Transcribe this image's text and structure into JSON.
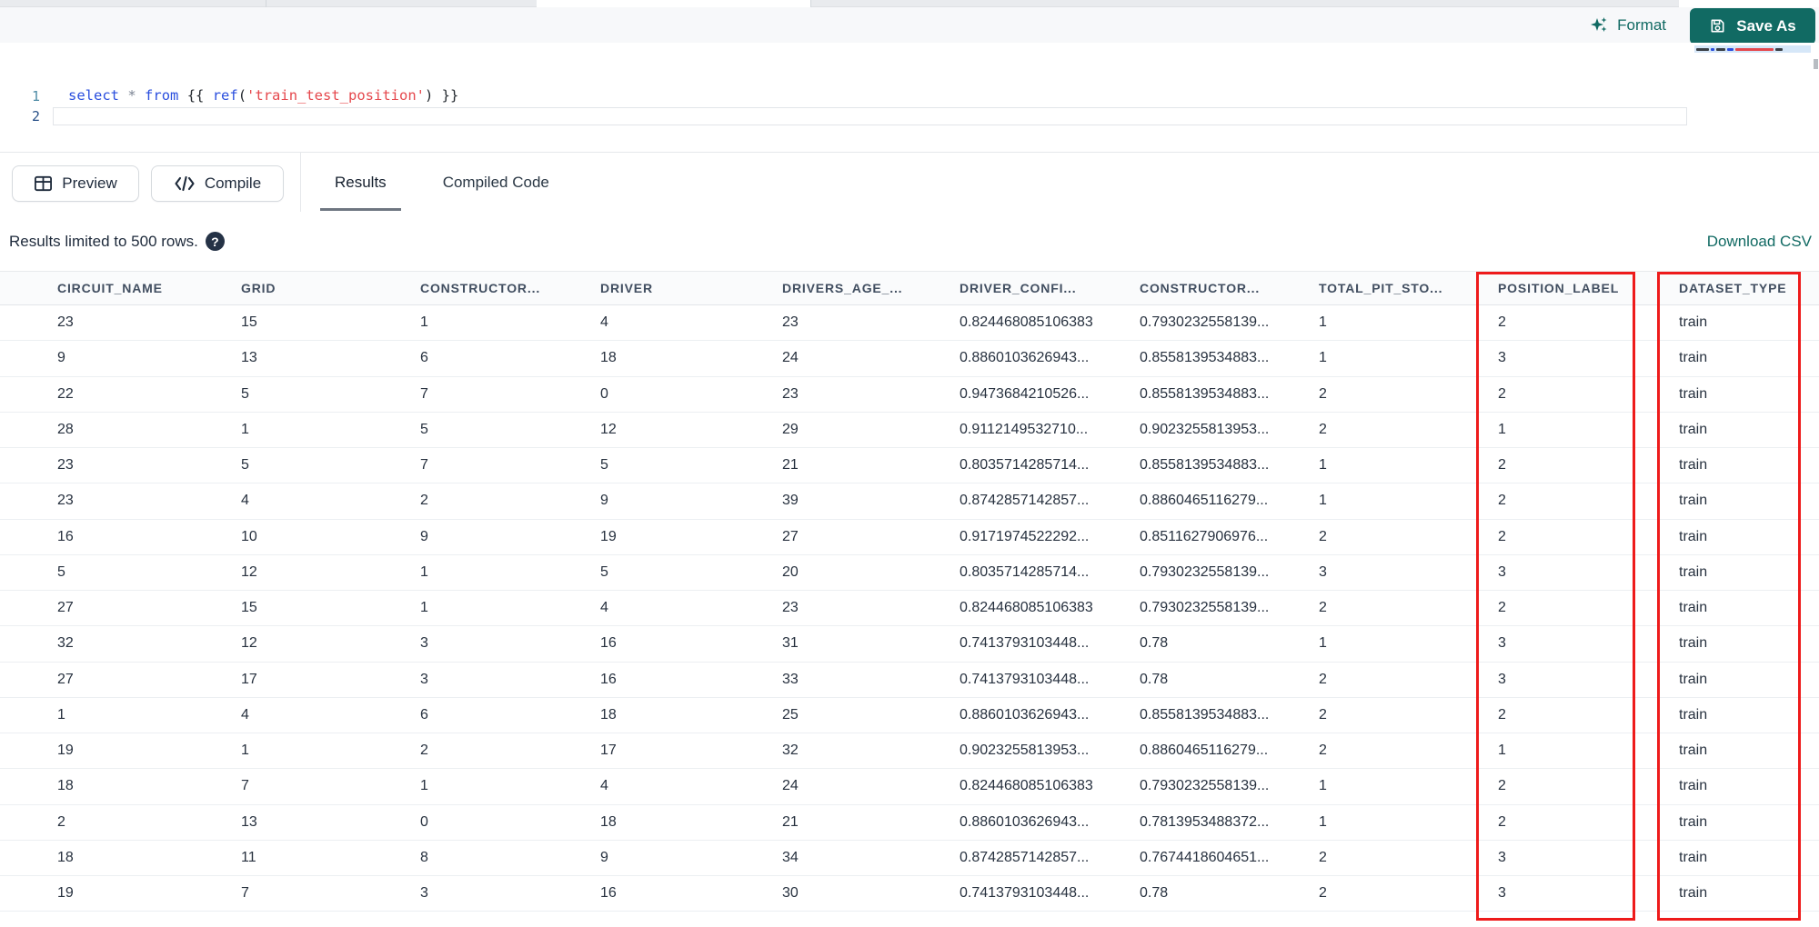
{
  "editor": {
    "line_numbers": [
      "1",
      "2"
    ],
    "code_tokens": [
      {
        "text": "select",
        "style": "keyword"
      },
      {
        "text": " ",
        "style": "plain"
      },
      {
        "text": "*",
        "style": "operator"
      },
      {
        "text": " ",
        "style": "plain"
      },
      {
        "text": "from",
        "style": "keyword"
      },
      {
        "text": " {{ ",
        "style": "plain"
      },
      {
        "text": "ref",
        "style": "keyword"
      },
      {
        "text": "(",
        "style": "plain"
      },
      {
        "text": "'train_test_position'",
        "style": "string"
      },
      {
        "text": ") ",
        "style": "plain"
      },
      {
        "text": "}}",
        "style": "plain"
      }
    ],
    "toolbar": {
      "format_label": "Format",
      "save_as_label": "Save As"
    },
    "colors": {
      "accent_teal": "#116A63",
      "keyword_blue": "#2B4FDE",
      "string_red": "#E5484D",
      "highlight_red": "#EE1B1B"
    }
  },
  "results_toolbar": {
    "preview_label": "Preview",
    "compile_label": "Compile",
    "tabs": [
      {
        "label": "Results",
        "active": true
      },
      {
        "label": "Compiled Code",
        "active": false
      }
    ]
  },
  "results_info": {
    "limit_text": "Results limited to 500 rows.",
    "help_glyph": "?",
    "download_label": "Download CSV"
  },
  "table": {
    "columns": [
      "CIRCUIT_NAME",
      "GRID",
      "CONSTRUCTOR...",
      "DRIVER",
      "DRIVERS_AGE_...",
      "DRIVER_CONFI...",
      "CONSTRUCTOR...",
      "TOTAL_PIT_STO...",
      "POSITION_LABEL",
      "DATASET_TYPE"
    ],
    "highlighted_columns": [
      "POSITION_LABEL",
      "DATASET_TYPE"
    ],
    "rows": [
      [
        "23",
        "15",
        "1",
        "4",
        "23",
        "0.824468085106383",
        "0.7930232558139...",
        "1",
        "2",
        "train"
      ],
      [
        "9",
        "13",
        "6",
        "18",
        "24",
        "0.8860103626943...",
        "0.8558139534883...",
        "1",
        "3",
        "train"
      ],
      [
        "22",
        "5",
        "7",
        "0",
        "23",
        "0.9473684210526...",
        "0.8558139534883...",
        "2",
        "2",
        "train"
      ],
      [
        "28",
        "1",
        "5",
        "12",
        "29",
        "0.9112149532710...",
        "0.9023255813953...",
        "2",
        "1",
        "train"
      ],
      [
        "23",
        "5",
        "7",
        "5",
        "21",
        "0.8035714285714...",
        "0.8558139534883...",
        "1",
        "2",
        "train"
      ],
      [
        "23",
        "4",
        "2",
        "9",
        "39",
        "0.8742857142857...",
        "0.8860465116279...",
        "1",
        "2",
        "train"
      ],
      [
        "16",
        "10",
        "9",
        "19",
        "27",
        "0.9171974522292...",
        "0.8511627906976...",
        "2",
        "2",
        "train"
      ],
      [
        "5",
        "12",
        "1",
        "5",
        "20",
        "0.8035714285714...",
        "0.7930232558139...",
        "3",
        "3",
        "train"
      ],
      [
        "27",
        "15",
        "1",
        "4",
        "23",
        "0.824468085106383",
        "0.7930232558139...",
        "2",
        "2",
        "train"
      ],
      [
        "32",
        "12",
        "3",
        "16",
        "31",
        "0.7413793103448...",
        "0.78",
        "1",
        "3",
        "train"
      ],
      [
        "27",
        "17",
        "3",
        "16",
        "33",
        "0.7413793103448...",
        "0.78",
        "2",
        "3",
        "train"
      ],
      [
        "1",
        "4",
        "6",
        "18",
        "25",
        "0.8860103626943...",
        "0.8558139534883...",
        "2",
        "2",
        "train"
      ],
      [
        "19",
        "1",
        "2",
        "17",
        "32",
        "0.9023255813953...",
        "0.8860465116279...",
        "2",
        "1",
        "train"
      ],
      [
        "18",
        "7",
        "1",
        "4",
        "24",
        "0.824468085106383",
        "0.7930232558139...",
        "1",
        "2",
        "train"
      ],
      [
        "2",
        "13",
        "0",
        "18",
        "21",
        "0.8860103626943...",
        "0.7813953488372...",
        "1",
        "2",
        "train"
      ],
      [
        "18",
        "11",
        "8",
        "9",
        "34",
        "0.8742857142857...",
        "0.7674418604651...",
        "2",
        "3",
        "train"
      ],
      [
        "19",
        "7",
        "3",
        "16",
        "30",
        "0.7413793103448...",
        "0.78",
        "2",
        "3",
        "train"
      ]
    ]
  }
}
